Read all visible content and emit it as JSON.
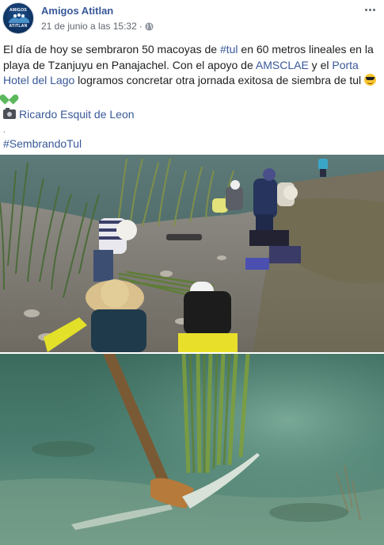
{
  "post": {
    "page_name": "Amigos Atitlan",
    "timestamp": "21 de junio a las 15:32",
    "separator": " · ",
    "privacy_icon": "globe-icon",
    "more_icon": "more-options-icon"
  },
  "avatar": {
    "top_text": "AMIGOS",
    "bottom_text": "ATITLAN"
  },
  "body": {
    "t1": "El día de hoy se sembraron 50 macoyas de ",
    "tag_tul": "#tul",
    "t2": " en 60 metros lineales en la playa de Tzanjuyu en Panajachel. Con el apoyo de ",
    "link_amsclae": "AMSCLAE",
    "t3": " y el ",
    "link_porta": "Porta Hotel del Lago",
    "t4": " logramos concretar otra jornada exitosa de siembra de tul",
    "photo_credit_icon": "camera-icon",
    "photo_credit": "Ricardo Esquit de Leon",
    "dot": ".",
    "hashtag": "#SembrandoTul"
  },
  "photos": {
    "top": "shoreline-planting-photo",
    "bottom": "underwater-tul-photo"
  },
  "colors": {
    "link": "#385898",
    "text": "#1c1e21",
    "meta": "#616770"
  }
}
